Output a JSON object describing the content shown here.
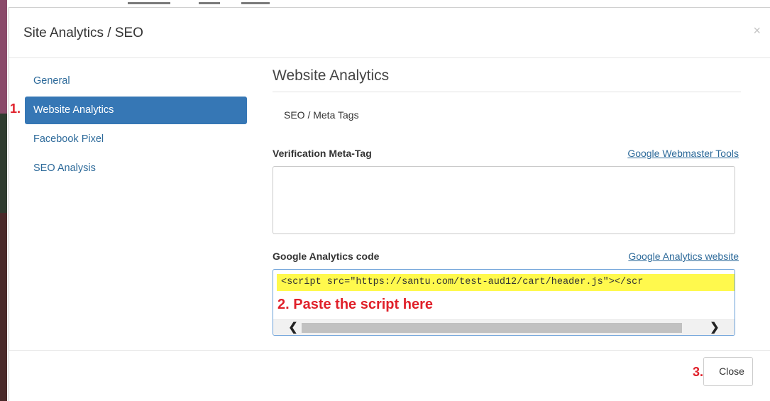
{
  "modal": {
    "title": "Site Analytics / SEO",
    "close_x": "×"
  },
  "sidebar": {
    "items": [
      {
        "label": "General",
        "active": false
      },
      {
        "label": "Website Analytics",
        "active": true
      },
      {
        "label": "Facebook Pixel",
        "active": false
      },
      {
        "label": "SEO Analysis",
        "active": false
      }
    ]
  },
  "annotations": {
    "step1": "1.",
    "step2": "2. Paste the script here",
    "step3": "3."
  },
  "main": {
    "section_title": "Website Analytics",
    "subtab": "SEO / Meta Tags",
    "verification": {
      "label": "Verification Meta-Tag",
      "link": "Google Webmaster Tools",
      "value": ""
    },
    "analytics": {
      "label": "Google Analytics code",
      "link": "Google Analytics website",
      "value": "<script src=\"https://santu.com/test-aud12/cart/header.js\"></scr"
    }
  },
  "scroll": {
    "left_arrow": "❮",
    "right_arrow": "❯"
  },
  "footer": {
    "close_label": "Close"
  },
  "colors": {
    "accent": "#3677b5",
    "link": "#2d6a9a",
    "highlight": "#fff94d",
    "annotation_red": "#e0202a"
  }
}
